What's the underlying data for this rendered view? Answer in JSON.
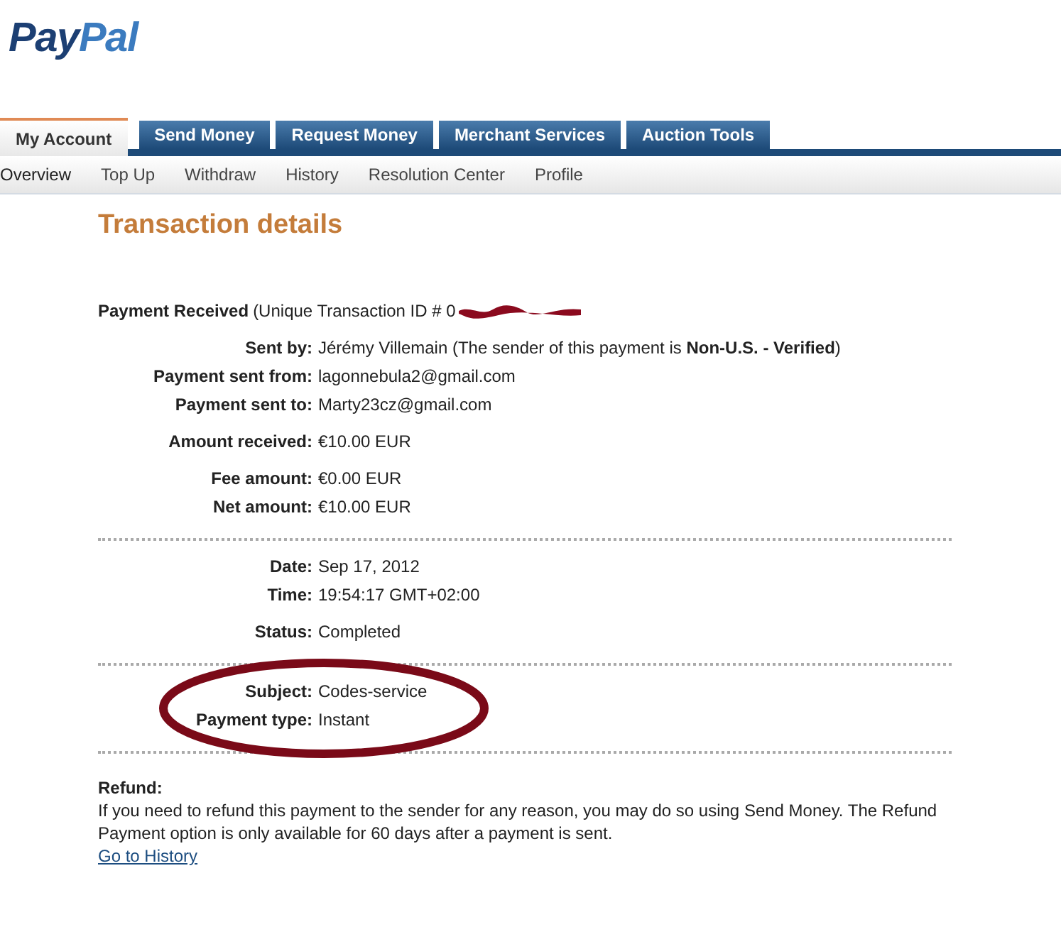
{
  "logo": {
    "first": "Pay",
    "second": "Pal"
  },
  "tabs": [
    {
      "label": "My Account",
      "selected": true
    },
    {
      "label": "Send Money",
      "selected": false
    },
    {
      "label": "Request Money",
      "selected": false
    },
    {
      "label": "Merchant Services",
      "selected": false
    },
    {
      "label": "Auction Tools",
      "selected": false
    }
  ],
  "subnav": [
    "Overview",
    "Top Up",
    "Withdraw",
    "History",
    "Resolution Center",
    "Profile"
  ],
  "title": "Transaction details",
  "heading": {
    "label": "Payment Received",
    "text": "(Unique Transaction ID # 0"
  },
  "groups": [
    {
      "divider_after": false,
      "highlighted": false,
      "rows": [
        {
          "label": "Sent by:",
          "value": "Jérémy Villemain (The sender of this payment is **Non-U.S. - Verified**)"
        },
        {
          "label": "Payment sent from:",
          "value": "lagonnebula2@gmail.com"
        },
        {
          "label": "Payment sent to:",
          "value": "Marty23cz@gmail.com"
        }
      ]
    },
    {
      "divider_after": false,
      "highlighted": false,
      "rows": [
        {
          "label": "Amount received:",
          "value": "€10.00 EUR"
        }
      ]
    },
    {
      "divider_after": true,
      "highlighted": false,
      "rows": [
        {
          "label": "Fee amount:",
          "value": "€0.00 EUR"
        },
        {
          "label": "Net amount:",
          "value": "€10.00 EUR"
        }
      ]
    },
    {
      "divider_after": false,
      "highlighted": false,
      "rows": [
        {
          "label": "Date:",
          "value": "Sep 17, 2012"
        },
        {
          "label": "Time:",
          "value": "19:54:17 GMT+02:00"
        }
      ]
    },
    {
      "divider_after": true,
      "highlighted": false,
      "rows": [
        {
          "label": "Status:",
          "value": "Completed"
        }
      ]
    },
    {
      "divider_after": true,
      "highlighted": true,
      "rows": [
        {
          "label": "Subject:",
          "value": "Codes-service"
        },
        {
          "label": "Payment type:",
          "value": "Instant"
        }
      ]
    }
  ],
  "refund": {
    "title": "Refund:",
    "text": "If you need to refund this payment to the sender for any reason, you may do so using Send Money. The Refund Payment option is only available for 60 days after a payment is sent.",
    "link": "Go to History"
  }
}
